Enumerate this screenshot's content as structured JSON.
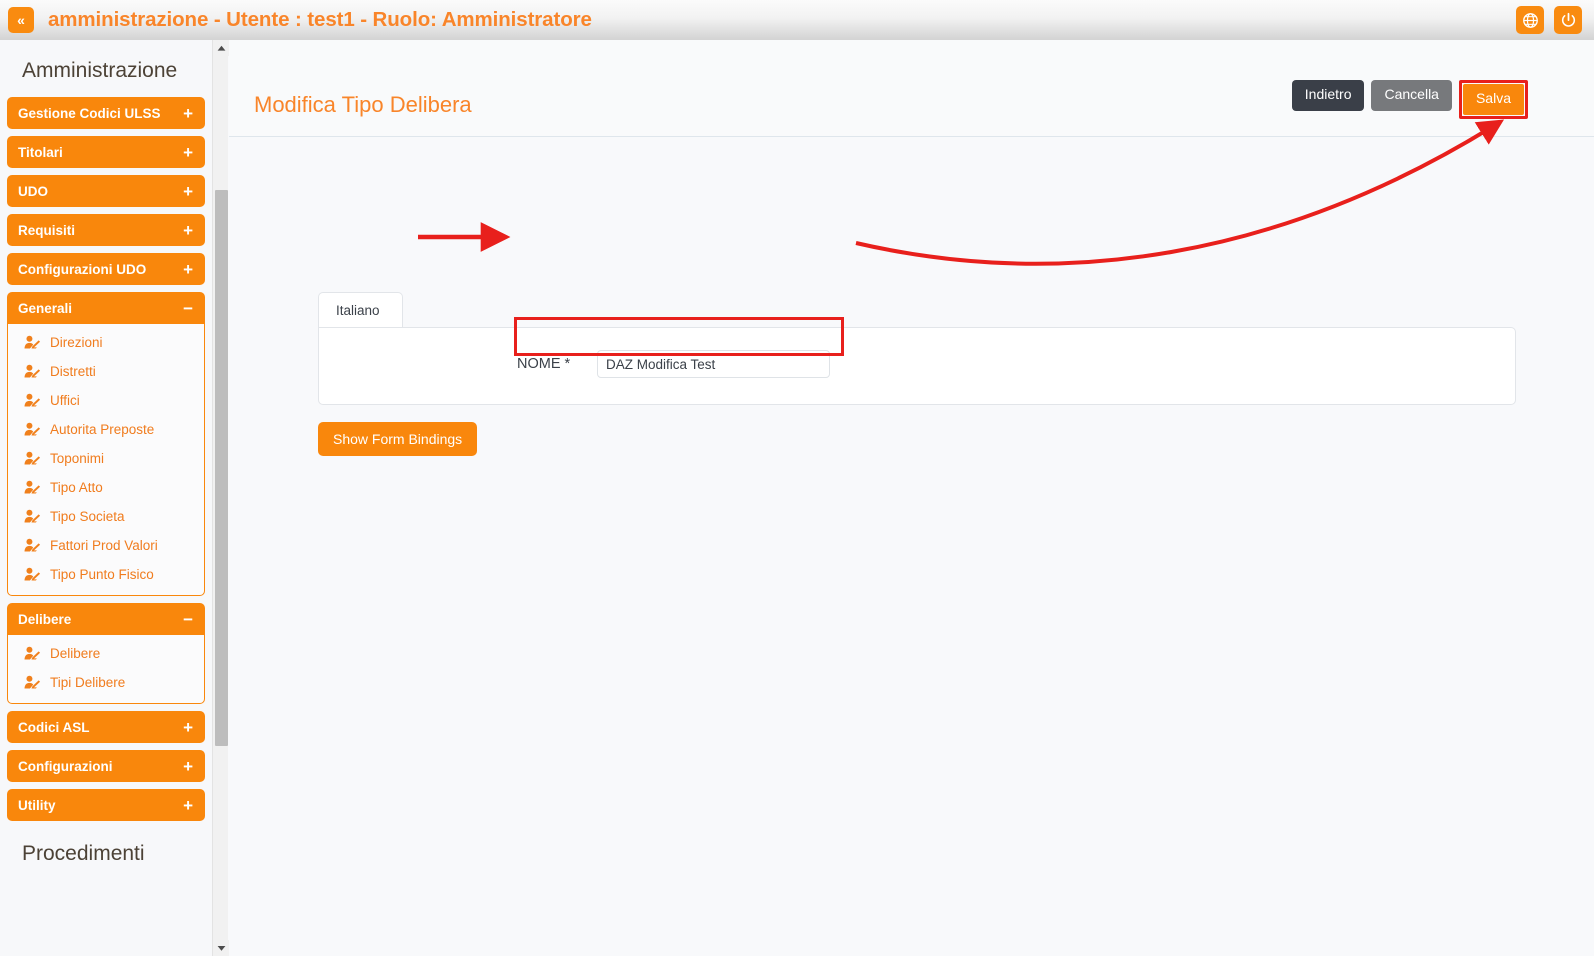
{
  "topbar": {
    "collapse_label": "«",
    "title": "amministrazione - Utente : test1 - Ruolo: Amministratore",
    "globe_icon": "globe-icon",
    "power_icon": "power-icon"
  },
  "sidebar": {
    "heading": "Amministrazione",
    "footer_heading": "Procedimenti",
    "expand_glyph": "+",
    "collapse_glyph": "−",
    "groups": [
      {
        "label": "Gestione Codici ULSS",
        "open": false,
        "items": []
      },
      {
        "label": "Titolari",
        "open": false,
        "items": []
      },
      {
        "label": "UDO",
        "open": false,
        "items": []
      },
      {
        "label": "Requisiti",
        "open": false,
        "items": []
      },
      {
        "label": "Configurazioni UDO",
        "open": false,
        "items": []
      },
      {
        "label": "Generali",
        "open": true,
        "items": [
          "Direzioni",
          "Distretti",
          "Uffici",
          "Autorita Preposte",
          "Toponimi",
          "Tipo Atto",
          "Tipo Societa",
          "Fattori Prod Valori",
          "Tipo Punto Fisico"
        ]
      },
      {
        "label": "Delibere",
        "open": true,
        "items": [
          "Delibere",
          "Tipi Delibere"
        ]
      },
      {
        "label": "Codici ASL",
        "open": false,
        "items": []
      },
      {
        "label": "Configurazioni",
        "open": false,
        "items": []
      },
      {
        "label": "Utility",
        "open": false,
        "items": []
      }
    ]
  },
  "main": {
    "page_title": "Modifica Tipo Delibera",
    "actions": {
      "back_label": "Indietro",
      "cancel_label": "Cancella",
      "save_label": "Salva"
    },
    "tabs": [
      {
        "label": "Italiano",
        "active": true
      }
    ],
    "form": {
      "fields": [
        {
          "label": "NOME *",
          "value": "DAZ Modifica Test",
          "placeholder": ""
        }
      ]
    },
    "show_bindings_label": "Show Form Bindings"
  },
  "colors": {
    "brand_orange": "#f9870c",
    "title_orange": "#f9852a",
    "annotation_red": "#e8201c",
    "dark_button": "#3a3f48",
    "gray_button": "#77797c"
  }
}
